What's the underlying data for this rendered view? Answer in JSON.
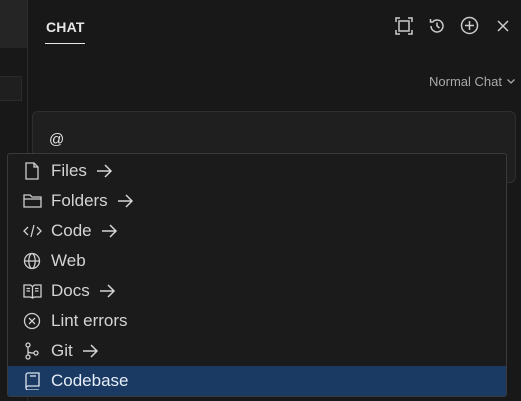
{
  "header": {
    "tab_label": "CHAT",
    "actions": [
      {
        "icon": "maximize-icon"
      },
      {
        "icon": "history-icon"
      },
      {
        "icon": "new-chat-plus-icon"
      },
      {
        "icon": "close-icon"
      }
    ]
  },
  "mode_selector": {
    "label": "Normal Chat",
    "icon": "chevron-down-icon"
  },
  "input": {
    "value": "@"
  },
  "menu": {
    "items": [
      {
        "label": "Files",
        "icon": "file-icon",
        "has_arrow": true,
        "selected": false
      },
      {
        "label": "Folders",
        "icon": "folder-icon",
        "has_arrow": true,
        "selected": false
      },
      {
        "label": "Code",
        "icon": "code-icon",
        "has_arrow": true,
        "selected": false
      },
      {
        "label": "Web",
        "icon": "globe-icon",
        "has_arrow": false,
        "selected": false
      },
      {
        "label": "Docs",
        "icon": "book-icon",
        "has_arrow": true,
        "selected": false
      },
      {
        "label": "Lint errors",
        "icon": "error-circle-icon",
        "has_arrow": false,
        "selected": false
      },
      {
        "label": "Git",
        "icon": "git-branch-icon",
        "has_arrow": true,
        "selected": false
      },
      {
        "label": "Codebase",
        "icon": "codebase-book-icon",
        "has_arrow": false,
        "selected": true
      }
    ]
  },
  "colors": {
    "background": "#181818",
    "selected_item": "#1a3a63",
    "text": "#d4d4d4"
  }
}
